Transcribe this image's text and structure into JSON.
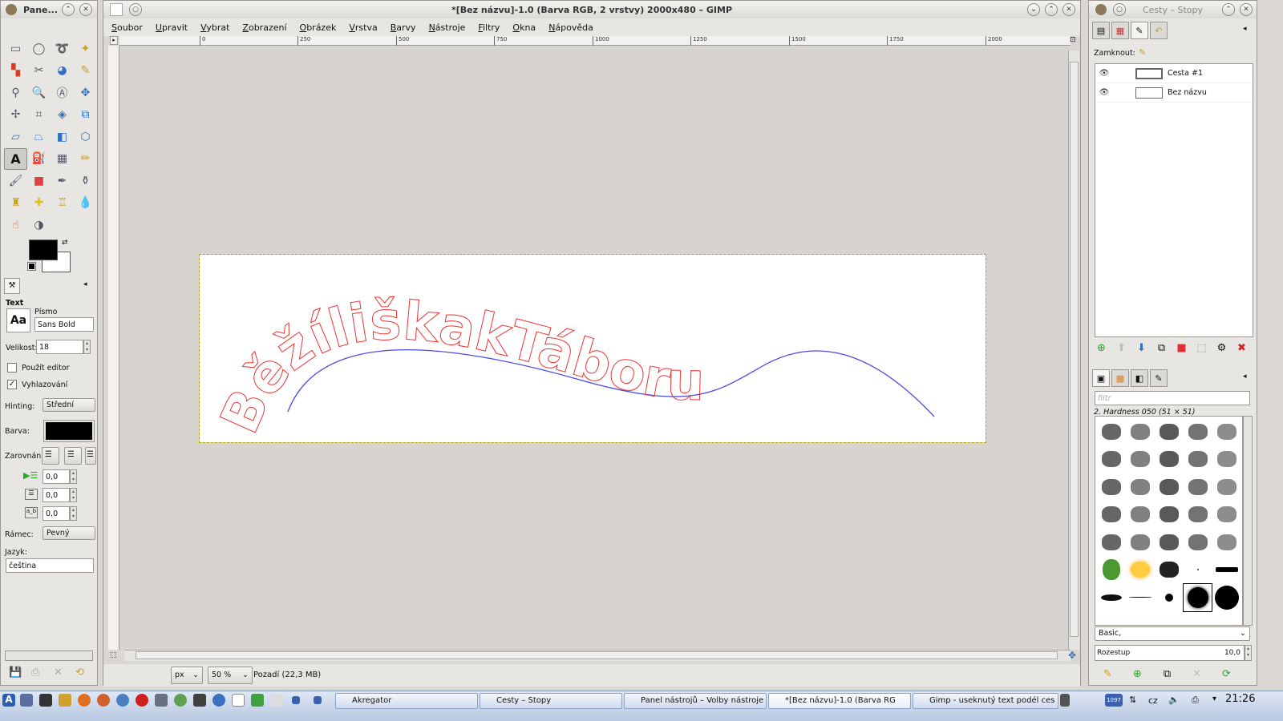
{
  "toolbox": {
    "title": "Pane...",
    "section_title": "Text",
    "font_label": "Písmo",
    "font_value": "Sans Bold",
    "size_label": "Velikost:",
    "size_value": "18",
    "use_editor": "Použít editor",
    "antialias": "Vyhlazování",
    "hinting_label": "Hinting:",
    "hinting_value": "Střední",
    "color_label": "Barva:",
    "justify_label": "Zarovnání:",
    "indent_value": "0,0",
    "line_spacing_value": "0,0",
    "letter_spacing_value": "0,0",
    "box_label": "Rámec:",
    "box_value": "Pevný",
    "language_label": "Jazyk:",
    "language_value": "čeština",
    "fg_color": "#000000",
    "bg_color": "#ffffff",
    "aa_glyph": "Aa"
  },
  "main": {
    "title": "*[Bez názvu]-1.0 (Barva RGB, 2 vrstvy) 2000x480 – GIMP",
    "menu": [
      "Soubor",
      "Upravit",
      "Vybrat",
      "Zobrazení",
      "Obrázek",
      "Vrstva",
      "Barvy",
      "Nástroje",
      "Filtry",
      "Okna",
      "Nápověda"
    ],
    "ruler_ticks": [
      "0",
      "250",
      "500",
      "750",
      "1000",
      "1250",
      "1500",
      "1750",
      "2000"
    ],
    "canvas_text": "BěžíliškakTáboru",
    "text_color": "#ee3333",
    "path_color": "#4a4ae8",
    "unit": "px",
    "zoom": "50 %",
    "status": "Pozadí (22,3 MB)"
  },
  "dock": {
    "title": "Cesty – Stopy",
    "lock_label": "Zamknout:",
    "paths": [
      "Cesta #1",
      "Bez názvu"
    ],
    "filter_placeholder": "filtr",
    "brush_name": "2. Hardness 050 (51 × 51)",
    "brush_tag": "Basic,",
    "spacing_label": "Rozestup",
    "spacing_value": "10,0"
  },
  "taskbar": {
    "tasks": [
      "Akregator",
      "Cesty – Stopy",
      "Panel nástrojů – Volby nástroje",
      "*[Bez názvu]-1.0 (Barva RG",
      "Gimp - useknutý text podél ces"
    ],
    "lang": "cz",
    "badge": "1097",
    "clock": "21:26"
  }
}
